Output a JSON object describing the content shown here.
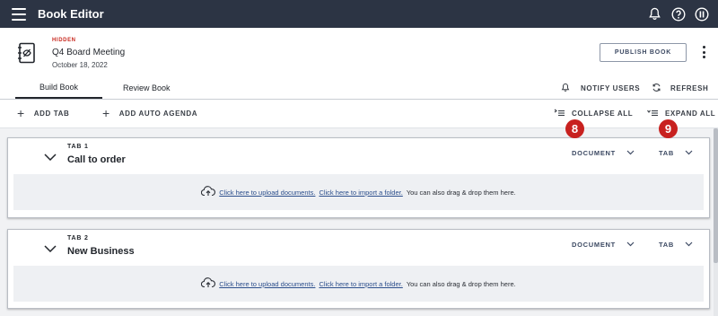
{
  "topbar": {
    "title": "Book Editor"
  },
  "book": {
    "status": "HIDDEN",
    "name": "Q4 Board Meeting",
    "date": "October 18, 2022",
    "publish_label": "PUBLISH BOOK"
  },
  "tabs": {
    "build": "Build Book",
    "review": "Review Book"
  },
  "actions": {
    "notify": "NOTIFY USERS",
    "refresh": "REFRESH"
  },
  "toolbar": {
    "add_tab": "ADD TAB",
    "add_agenda": "ADD AUTO AGENDA",
    "collapse_all": "COLLAPSE ALL",
    "expand_all": "EXPAND ALL"
  },
  "badges": {
    "collapse": "8",
    "expand": "9"
  },
  "cards": [
    {
      "label": "TAB 1",
      "title": "Call to order",
      "document_label": "DOCUMENT",
      "tab_label": "TAB",
      "upload_link": "Click here to upload documents.",
      "import_link": "Click here to import a folder.",
      "drag_text": "You can also drag & drop them here."
    },
    {
      "label": "TAB 2",
      "title": "New Business",
      "document_label": "DOCUMENT",
      "tab_label": "TAB",
      "upload_link": "Click here to upload documents.",
      "import_link": "Click here to import a folder.",
      "drag_text": "You can also drag & drop them here."
    }
  ],
  "colors": {
    "topbar": "#2c3444",
    "status": "#c8281e",
    "badge": "#c8211f",
    "link": "#2c4f8c"
  }
}
